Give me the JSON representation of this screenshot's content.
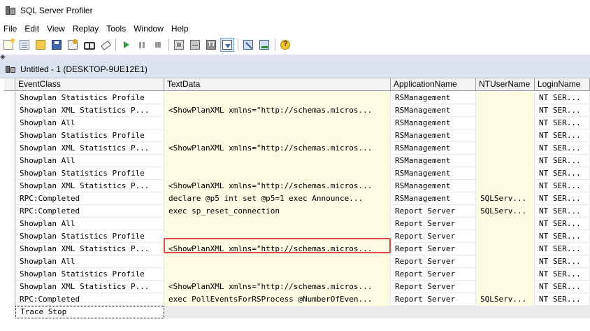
{
  "window": {
    "title": "SQL Server Profiler"
  },
  "menu": [
    "File",
    "Edit",
    "View",
    "Replay",
    "Tools",
    "Window",
    "Help"
  ],
  "toolbar": {
    "buttons": [
      {
        "name": "new-trace-icon"
      },
      {
        "name": "new-template-icon"
      },
      {
        "name": "open-folder-icon"
      },
      {
        "name": "save-icon"
      },
      {
        "name": "properties-icon"
      },
      {
        "name": "find-icon"
      },
      {
        "name": "clear-trace-icon"
      },
      {
        "name": "run-trace-icon"
      },
      {
        "name": "pause-trace-icon"
      },
      {
        "name": "stop-trace-icon"
      },
      {
        "name": "properties-grid-icon"
      },
      {
        "name": "group-icon"
      },
      {
        "name": "tt-icon"
      },
      {
        "name": "auto-scroll-icon"
      },
      {
        "name": "tuning-advisor-icon"
      },
      {
        "name": "performance-monitor-icon"
      },
      {
        "name": "help-icon"
      }
    ]
  },
  "trace_window": {
    "title": "Untitled - 1 (DESKTOP-9UE12E1)"
  },
  "grid": {
    "columns": [
      "EventClass",
      "TextData",
      "ApplicationName",
      "NTUserName",
      "LoginName"
    ],
    "rows": [
      [
        "Showplan Statistics Profile",
        "",
        "RSManagement",
        "",
        "NT SER..."
      ],
      [
        "Showplan XML Statistics P...",
        "<ShowPlanXML xmlns=\"http://schemas.micros...",
        "RSManagement",
        "",
        "NT SER..."
      ],
      [
        "Showplan All",
        "",
        "RSManagement",
        "",
        "NT SER..."
      ],
      [
        "Showplan Statistics Profile",
        "",
        "RSManagement",
        "",
        "NT SER..."
      ],
      [
        "Showplan XML Statistics P...",
        "<ShowPlanXML xmlns=\"http://schemas.micros...",
        "RSManagement",
        "",
        "NT SER..."
      ],
      [
        "Showplan All",
        "",
        "RSManagement",
        "",
        "NT SER..."
      ],
      [
        "Showplan Statistics Profile",
        "",
        "RSManagement",
        "",
        "NT SER..."
      ],
      [
        "Showplan XML Statistics P...",
        "<ShowPlanXML xmlns=\"http://schemas.micros...",
        "RSManagement",
        "",
        "NT SER..."
      ],
      [
        "RPC:Completed",
        "declare @p5 int  set @p5=1  exec Announce...",
        "RSManagement",
        "SQLServ...",
        "NT SER..."
      ],
      [
        "RPC:Completed",
        "exec sp_reset_connection",
        "Report Server",
        "SQLServ...",
        "NT SER..."
      ],
      [
        "Showplan All",
        "",
        "Report Server",
        "",
        "NT SER..."
      ],
      [
        "Showplan Statistics Profile",
        "",
        "Report Server",
        "",
        "NT SER..."
      ],
      [
        "Showplan XML Statistics P...",
        "<ShowPlanXML xmlns=\"http://schemas.micros...",
        "Report Server",
        "",
        "NT SER..."
      ],
      [
        "Showplan All",
        "",
        "Report Server",
        "",
        "NT SER..."
      ],
      [
        "Showplan Statistics Profile",
        "",
        "Report Server",
        "",
        "NT SER..."
      ],
      [
        "Showplan XML Statistics P...",
        "<ShowPlanXML xmlns=\"http://schemas.micros...",
        "Report Server",
        "",
        "NT SER..."
      ],
      [
        "RPC:Completed",
        "exec PollEventsForRSProcess @NumberOfEven...",
        "Report Server",
        "SQLServ...",
        "NT SER..."
      ]
    ],
    "final_row": "Trace Stop"
  },
  "colors": {
    "title_area": "#dbe3ef",
    "highlight_cell": "#fcfce3",
    "annotation_box": "#e0474b"
  }
}
